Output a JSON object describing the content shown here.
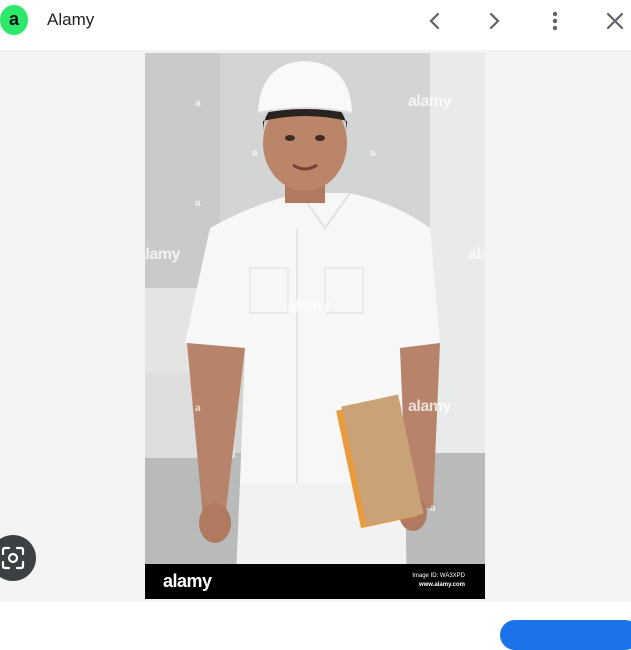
{
  "header": {
    "site_logo_letter": "a",
    "site_name": "Alamy",
    "icons": {
      "prev": "chevron-left-icon",
      "next": "chevron-right-icon",
      "more": "more-vert-icon",
      "close": "close-icon"
    }
  },
  "image": {
    "watermark_text": "alamy",
    "watermark_short": "a",
    "footer_logo": "alamy",
    "footer_image_id": "Image ID: WA3XPD",
    "footer_url": "www.alamy.com"
  },
  "colors": {
    "logo_bg": "#2ee86b",
    "accent": "#1a73e8",
    "lens_bg": "#3c4043",
    "stage_bg": "#f1f3f4"
  }
}
